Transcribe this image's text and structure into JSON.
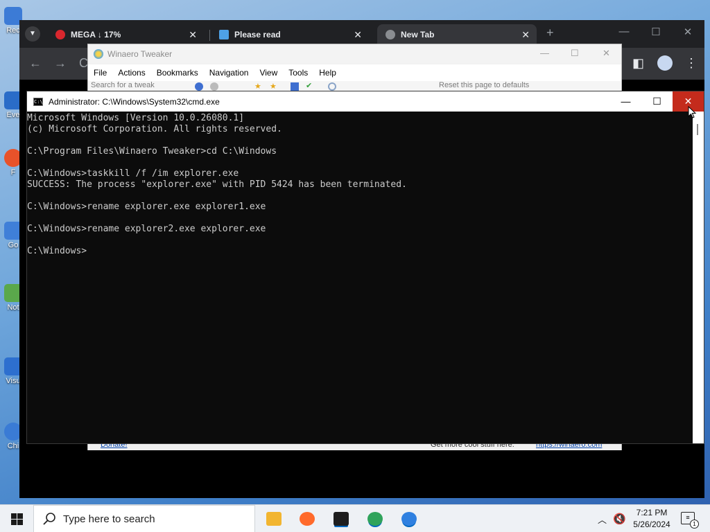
{
  "desktop": {
    "icons": [
      {
        "label": "Rec",
        "color": "#3c7bd6"
      },
      {
        "label": "Eve",
        "color": "#2a6cc8"
      },
      {
        "label": "F",
        "color": "#e8522a"
      },
      {
        "label": "Go",
        "color": "#3f7fd8"
      },
      {
        "label": "Not",
        "color": "#5aa84b"
      },
      {
        "label": "Visu",
        "color": "#2d6fcf"
      },
      {
        "label": "Chi",
        "color": "#3a7bd5"
      }
    ]
  },
  "chrome": {
    "tabs": [
      {
        "title": "MEGA ↓ 17%",
        "favicon_color": "#d9272e",
        "active": false
      },
      {
        "title": "Please read",
        "favicon_color": "#4ea1e6",
        "active": false
      },
      {
        "title": "New Tab",
        "favicon_color": "#8a8d91",
        "active": true
      }
    ],
    "new_tab_glyph": "+",
    "close_glyph": "✕",
    "controls": {
      "minimize": "—",
      "maximize": "☐",
      "close": "✕"
    },
    "toolbar": {
      "back": "←",
      "forward": "→",
      "reload": "C",
      "side_panel": "◧",
      "menu": "⋮"
    }
  },
  "winaero": {
    "title": "Winaero Tweaker",
    "controls": {
      "minimize": "—",
      "maximize": "☐",
      "close": "✕"
    },
    "menu": [
      "File",
      "Actions",
      "Bookmarks",
      "Navigation",
      "View",
      "Tools",
      "Help"
    ],
    "search_placeholder": "Search for a tweak",
    "reset_label": "Reset this page to defaults",
    "footer_donate": "Donate!",
    "footer_cool": "Get more cool stuff here:",
    "footer_link": "https://winaero.com"
  },
  "cmd": {
    "title": "Administrator: C:\\Windows\\System32\\cmd.exe",
    "controls": {
      "minimize": "—",
      "maximize": "☐",
      "close": "✕"
    },
    "lines": [
      "Microsoft Windows [Version 10.0.26080.1]",
      "(c) Microsoft Corporation. All rights reserved.",
      "",
      "C:\\Program Files\\Winaero Tweaker>cd C:\\Windows",
      "",
      "C:\\Windows>taskkill /f /im explorer.exe",
      "SUCCESS: The process \"explorer.exe\" with PID 5424 has been terminated.",
      "",
      "C:\\Windows>rename explorer.exe explorer1.exe",
      "",
      "C:\\Windows>rename explorer2.exe explorer.exe",
      "",
      "C:\\Windows>"
    ]
  },
  "taskbar": {
    "search_placeholder": "Type here to search",
    "apps": [
      {
        "name": "File Explorer",
        "color": "#f2b530"
      },
      {
        "name": "Firefox",
        "color": "#ff6a2b"
      },
      {
        "name": "Terminal",
        "color": "#1e1e1e"
      },
      {
        "name": "Edge",
        "color": "#2fa35b"
      },
      {
        "name": "Chrome",
        "color": "#2f80e0"
      }
    ],
    "time": "7:21 PM",
    "date": "5/26/2024",
    "notification_count": "1"
  }
}
